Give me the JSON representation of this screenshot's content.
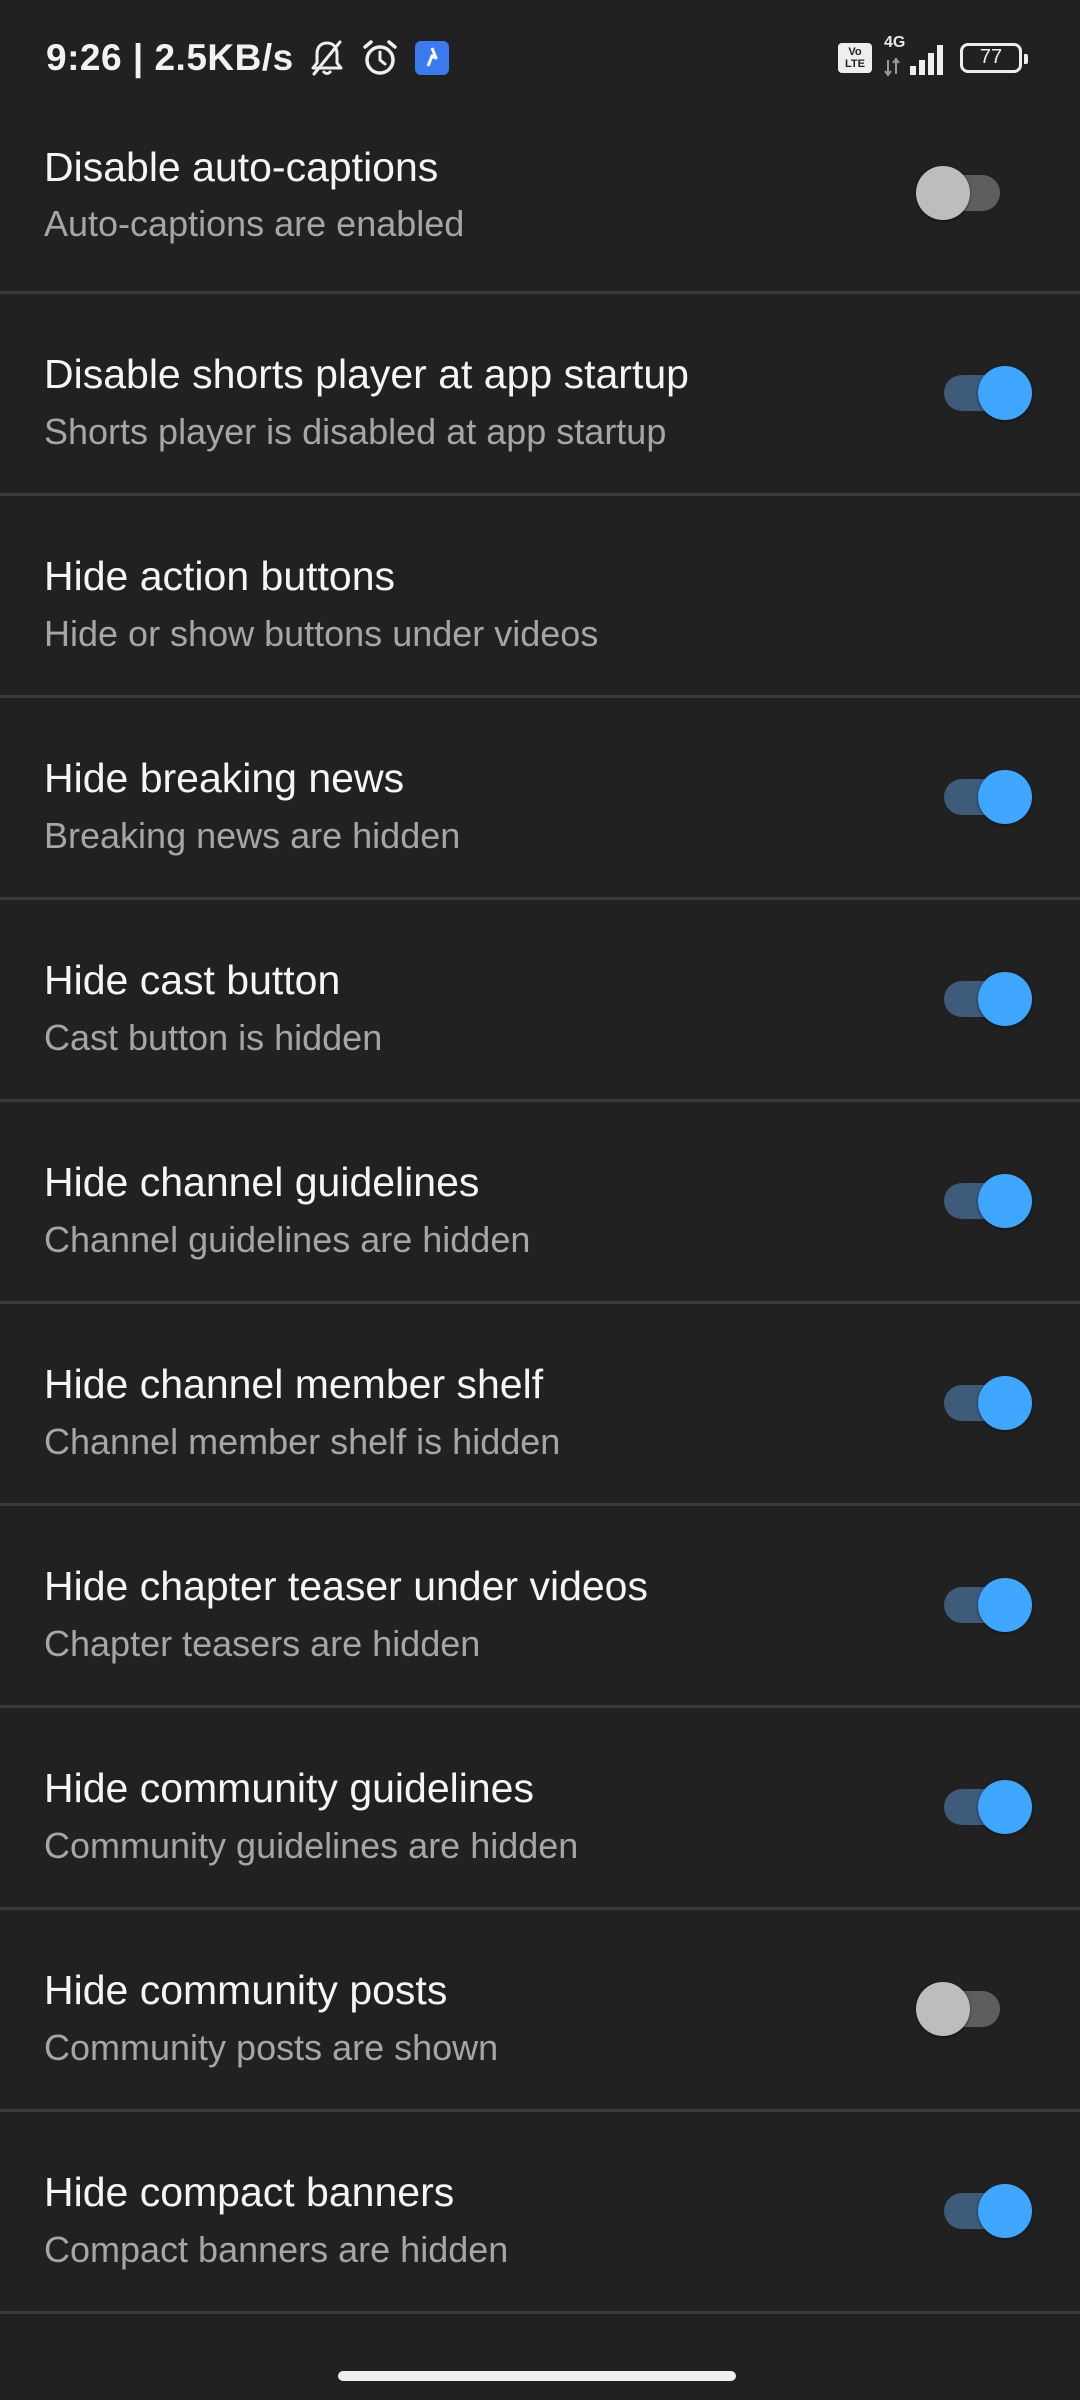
{
  "status_bar": {
    "time": "9:26 | 2.5KB/s",
    "volte": "Vo LTE",
    "network": "4G",
    "battery": "77",
    "icons": [
      "mute-bell-icon",
      "alarm-icon",
      "app-notification-icon",
      "volte-icon",
      "signal-icon",
      "battery-icon"
    ]
  },
  "settings": [
    {
      "title": "Disable auto-captions",
      "subtitle": "Auto-captions are enabled",
      "toggle": "off"
    },
    {
      "title": "Disable shorts player at app startup",
      "subtitle": "Shorts player is disabled at app startup",
      "toggle": "on"
    },
    {
      "title": "Hide action buttons",
      "subtitle": "Hide or show buttons under videos",
      "toggle": "none"
    },
    {
      "title": "Hide breaking news",
      "subtitle": "Breaking news are hidden",
      "toggle": "on"
    },
    {
      "title": "Hide cast button",
      "subtitle": "Cast button is hidden",
      "toggle": "on"
    },
    {
      "title": "Hide channel guidelines",
      "subtitle": "Channel guidelines are hidden",
      "toggle": "on"
    },
    {
      "title": "Hide channel member shelf",
      "subtitle": "Channel member shelf is hidden",
      "toggle": "on"
    },
    {
      "title": "Hide chapter teaser under videos",
      "subtitle": "Chapter teasers are hidden",
      "toggle": "on"
    },
    {
      "title": "Hide community guidelines",
      "subtitle": "Community guidelines are hidden",
      "toggle": "on"
    },
    {
      "title": "Hide community posts",
      "subtitle": "Community posts are shown",
      "toggle": "off"
    },
    {
      "title": "Hide compact banners",
      "subtitle": "Compact banners are hidden",
      "toggle": "on"
    }
  ],
  "colors": {
    "background": "#212121",
    "divider": "#3a3a3a",
    "toggle_on_thumb": "#3ea6ff",
    "toggle_on_track": "#3f5b7a",
    "toggle_off_thumb": "#bdbdbd",
    "toggle_off_track": "#5e5e5e"
  }
}
